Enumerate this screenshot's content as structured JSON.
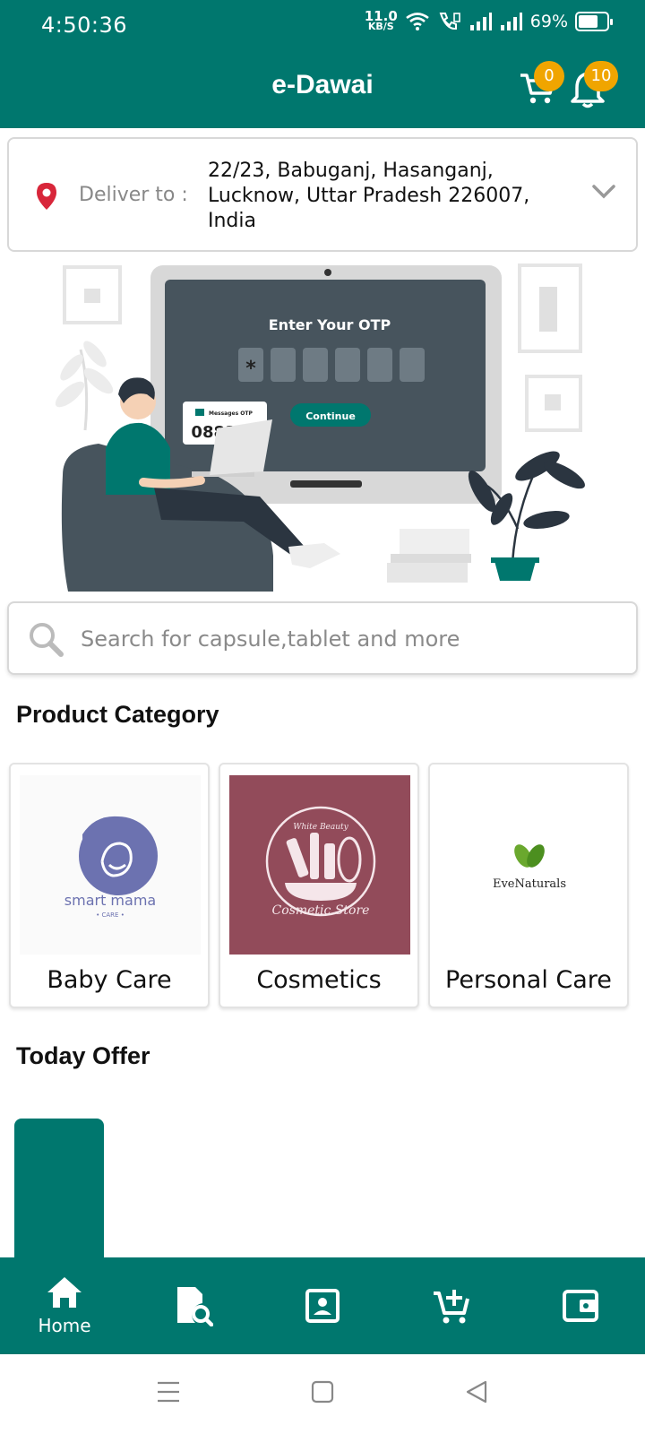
{
  "status_bar": {
    "time": "4:50:36",
    "net_speed_value": "11.0",
    "net_speed_unit": "KB/S",
    "battery_percent": "69%",
    "battery_level": 0.69
  },
  "app_bar": {
    "title": "e-Dawai",
    "cart_count": "0",
    "notification_count": "10",
    "color": "#00776e",
    "badge_color": "#f0a500"
  },
  "delivery": {
    "label": "Deliver to :",
    "address": "22/23, Babuganj, Hasanganj, Lucknow, Uttar Pradesh 226007, India",
    "pin_color": "#d8263a"
  },
  "banner": {
    "otp_title": "Enter Your OTP",
    "otp_first_char": "*",
    "continue_label": "Continue",
    "message_header": "Messages OTP",
    "message_code": "088123"
  },
  "search": {
    "placeholder": "Search for capsule,tablet and more"
  },
  "product_category": {
    "title": "Product Category",
    "items": [
      {
        "label": "Baby Care",
        "logo_text": "smart mama",
        "logo_sub": "• CARE •"
      },
      {
        "label": "Cosmetics",
        "logo_top": "White Beauty",
        "logo_text": "Cosmetic Store"
      },
      {
        "label": "Personal Care",
        "logo_text": "EveNaturals"
      }
    ]
  },
  "today_offer": {
    "title": "Today Offer"
  },
  "bottom_nav": {
    "items": [
      {
        "icon": "home-icon",
        "label": "Home"
      },
      {
        "icon": "prescription-search-icon",
        "label": ""
      },
      {
        "icon": "contact-card-icon",
        "label": ""
      },
      {
        "icon": "add-cart-icon",
        "label": ""
      },
      {
        "icon": "wallet-icon",
        "label": ""
      }
    ]
  }
}
